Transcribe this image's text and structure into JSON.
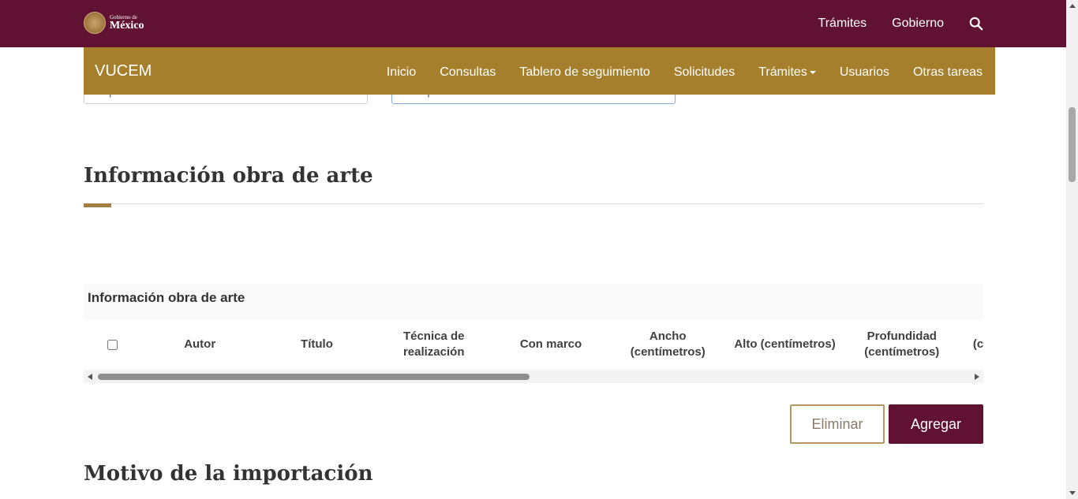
{
  "gov_header": {
    "logo_small": "Gobierno de",
    "logo_big": "México",
    "nav": [
      "Trámites",
      "Gobierno"
    ]
  },
  "vucem": {
    "brand": "VUCEM",
    "nav": [
      "Inicio",
      "Consultas",
      "Tablero de seguimiento",
      "Solicitudes",
      "Trámites",
      "Usuarios",
      "Otras tareas"
    ]
  },
  "form": {
    "left_input_value": "importación",
    "right_input_value": "Temporal"
  },
  "section_artwork": {
    "title": "Información obra de arte",
    "table_caption": "Información obra de arte",
    "columns": [
      "Autor",
      "Título",
      "Técnica de realización",
      "Con marco",
      "Ancho (centímetros)",
      "Alto (centímetros)",
      "Profundidad (centímetros)",
      "(ce"
    ]
  },
  "actions": {
    "delete_label": "Eliminar",
    "add_label": "Agregar"
  },
  "section_reason": {
    "title": "Motivo de la importación"
  },
  "colors": {
    "gov_bar": "#611232",
    "vucem_bar": "#a57f2c",
    "accent": "#a57f45"
  }
}
